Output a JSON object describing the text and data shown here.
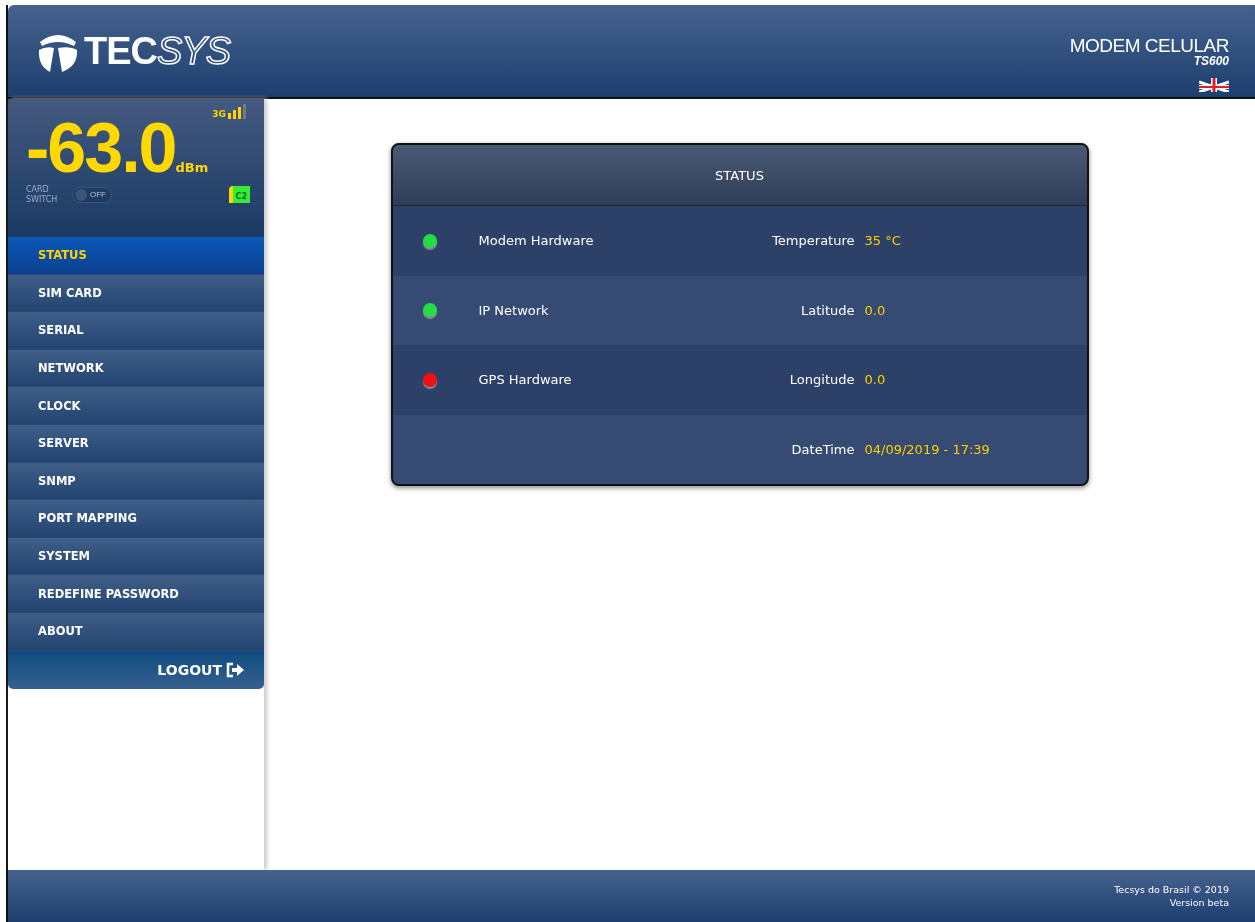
{
  "header": {
    "logo": {
      "bold": "TEC",
      "outline": "SYS"
    },
    "product": "MODEM CELULAR",
    "model": "TS600"
  },
  "signal": {
    "network": "3G",
    "reading": "-63.0",
    "unit": "dBm",
    "card_switch": {
      "label": "CARD SWITCH",
      "toggle": "OFF",
      "on": false
    },
    "sim": "C2"
  },
  "menu": [
    {
      "label": "STATUS",
      "selected": true
    },
    {
      "label": "SIM CARD",
      "selected": false
    },
    {
      "label": "SERIAL",
      "selected": false
    },
    {
      "label": "NETWORK",
      "selected": false
    },
    {
      "label": "CLOCK",
      "selected": false
    },
    {
      "label": "SERVER",
      "selected": false
    },
    {
      "label": "SNMP",
      "selected": false
    },
    {
      "label": "PORT MAPPING",
      "selected": false
    },
    {
      "label": "SYSTEM",
      "selected": false
    },
    {
      "label": "REDEFINE PASSWORD",
      "selected": false
    },
    {
      "label": "ABOUT",
      "selected": false
    }
  ],
  "logout": "LOGOUT",
  "status": {
    "title": "STATUS",
    "rows": [
      {
        "indicator": {
          "label": "Modem Hardware",
          "color": "#22dd44"
        },
        "field": "Temperature",
        "value": "35 °C"
      },
      {
        "indicator": {
          "label": "IP Network",
          "color": "#22dd44"
        },
        "field": "Latitude",
        "value": "0.0"
      },
      {
        "indicator": {
          "label": "GPS Hardware",
          "color": "#ee1111"
        },
        "field": "Longitude",
        "value": "0.0"
      },
      {
        "field": "DateTime",
        "value": "04/09/2019 - 17:39"
      }
    ]
  },
  "footer": {
    "copyright": "Tecsys do Brasil © 2019",
    "version": "Version beta"
  }
}
